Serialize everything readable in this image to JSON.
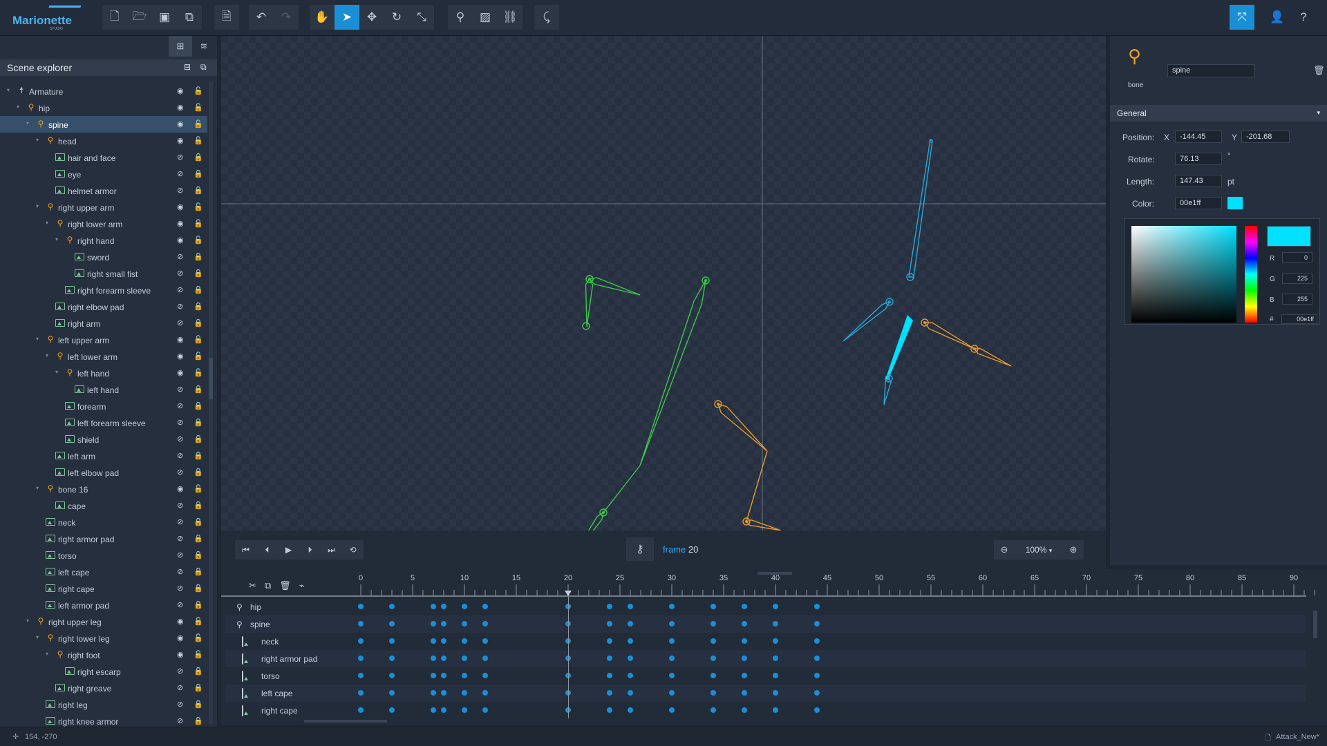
{
  "app": {
    "logo": "Marionette",
    "logo_sub": "STUDIO"
  },
  "toolbar": {
    "file": [
      "new-file-icon",
      "open-folder-icon",
      "save-icon",
      "save-as-icon"
    ],
    "export": [
      "export-icon"
    ],
    "history": [
      "undo-icon",
      "redo-icon"
    ],
    "tools": [
      "pan-hand-icon",
      "select-arrow-icon",
      "move-icon",
      "rotate-icon",
      "scale-icon"
    ],
    "create": [
      "add-bone-icon",
      "add-image-icon",
      "link-icon"
    ],
    "ik": [
      "ik-icon"
    ]
  },
  "left_panel": {
    "title": "Scene explorer"
  },
  "tree": [
    {
      "label": "Armature",
      "type": "armature",
      "depth": 0,
      "open": true
    },
    {
      "label": "hip",
      "type": "bone",
      "depth": 1,
      "open": true
    },
    {
      "label": "spine",
      "type": "bone",
      "depth": 2,
      "open": true,
      "selected": true
    },
    {
      "label": "head",
      "type": "bone",
      "depth": 3,
      "open": true
    },
    {
      "label": "hair and face",
      "type": "image",
      "depth": 4
    },
    {
      "label": "eye",
      "type": "image",
      "depth": 4
    },
    {
      "label": "helmet armor",
      "type": "image",
      "depth": 4
    },
    {
      "label": "right upper arm",
      "type": "bone",
      "depth": 3,
      "open": true
    },
    {
      "label": "right lower arm",
      "type": "bone",
      "depth": 4,
      "open": true
    },
    {
      "label": "right hand",
      "type": "bone",
      "depth": 5,
      "open": true
    },
    {
      "label": "sword",
      "type": "image",
      "depth": 6
    },
    {
      "label": "right small fist",
      "type": "image",
      "depth": 6
    },
    {
      "label": "right forearm sleeve",
      "type": "image",
      "depth": 5
    },
    {
      "label": "right elbow pad",
      "type": "image",
      "depth": 4
    },
    {
      "label": "right arm",
      "type": "image",
      "depth": 4
    },
    {
      "label": "left upper arm",
      "type": "bone",
      "depth": 3,
      "open": true
    },
    {
      "label": "left lower arm",
      "type": "bone",
      "depth": 4,
      "open": true
    },
    {
      "label": "left hand",
      "type": "bone",
      "depth": 5,
      "open": true
    },
    {
      "label": "left hand",
      "type": "image",
      "depth": 6
    },
    {
      "label": "forearm",
      "type": "image",
      "depth": 5
    },
    {
      "label": "left forearm sleeve",
      "type": "image",
      "depth": 5
    },
    {
      "label": "shield",
      "type": "image",
      "depth": 5
    },
    {
      "label": "left arm",
      "type": "image",
      "depth": 4
    },
    {
      "label": "left elbow pad",
      "type": "image",
      "depth": 4
    },
    {
      "label": "bone 16",
      "type": "bone",
      "depth": 3,
      "open": true
    },
    {
      "label": "cape",
      "type": "image",
      "depth": 4
    },
    {
      "label": "neck",
      "type": "image",
      "depth": 3
    },
    {
      "label": "right armor pad",
      "type": "image",
      "depth": 3
    },
    {
      "label": "torso",
      "type": "image",
      "depth": 3
    },
    {
      "label": "left cape",
      "type": "image",
      "depth": 3
    },
    {
      "label": "right cape",
      "type": "image",
      "depth": 3
    },
    {
      "label": "left armor pad",
      "type": "image",
      "depth": 3
    },
    {
      "label": "right upper leg",
      "type": "bone",
      "depth": 2,
      "open": true
    },
    {
      "label": "right lower leg",
      "type": "bone",
      "depth": 3,
      "open": true
    },
    {
      "label": "right foot",
      "type": "bone",
      "depth": 4,
      "open": true
    },
    {
      "label": "right escarp",
      "type": "image",
      "depth": 5
    },
    {
      "label": "right greave",
      "type": "image",
      "depth": 4
    },
    {
      "label": "right leg",
      "type": "image",
      "depth": 3
    },
    {
      "label": "right knee armor",
      "type": "image",
      "depth": 3
    }
  ],
  "playback": {
    "frame_label": "frame",
    "frame_value": "20",
    "zoom": "100%"
  },
  "properties": {
    "type_label": "bone",
    "name": "spine",
    "section": "General",
    "position_label": "Position:",
    "x_label": "X",
    "x": "-144.45",
    "y_label": "Y",
    "y": "-201.68",
    "rotate_label": "Rotate:",
    "rotate": "76.13",
    "rotate_unit": "°",
    "length_label": "Length:",
    "length": "147.43",
    "length_unit": "pt",
    "color_label": "Color:",
    "color": "00e1ff",
    "r_label": "R",
    "r": "0",
    "g_label": "G",
    "g": "225",
    "b_label": "B",
    "b": "255",
    "hex_label": "#",
    "hex": "00e1ff"
  },
  "colors": {
    "accent": "#1a8fd6",
    "bone_cyan": "#00e1ff",
    "green": "#3ec84a",
    "orange": "#e89a2a"
  },
  "timeline": {
    "ticks": [
      "0",
      "5",
      "10",
      "15",
      "20",
      "25",
      "30",
      "35",
      "40",
      "45",
      "50",
      "55",
      "60",
      "65",
      "70",
      "75",
      "80",
      "85",
      "90"
    ],
    "current_frame": 20,
    "rows": [
      {
        "label": "hip",
        "type": "bone"
      },
      {
        "label": "spine",
        "type": "bone"
      },
      {
        "label": "neck",
        "type": "image"
      },
      {
        "label": "right armor pad",
        "type": "image"
      },
      {
        "label": "torso",
        "type": "image"
      },
      {
        "label": "left cape",
        "type": "image"
      },
      {
        "label": "right cape",
        "type": "image"
      }
    ],
    "keyframes": [
      0,
      3,
      7,
      8,
      10,
      12,
      20,
      24,
      26,
      30,
      34,
      37,
      40,
      44
    ]
  },
  "status": {
    "coords": "154, -270",
    "file": "Attack_New*"
  }
}
